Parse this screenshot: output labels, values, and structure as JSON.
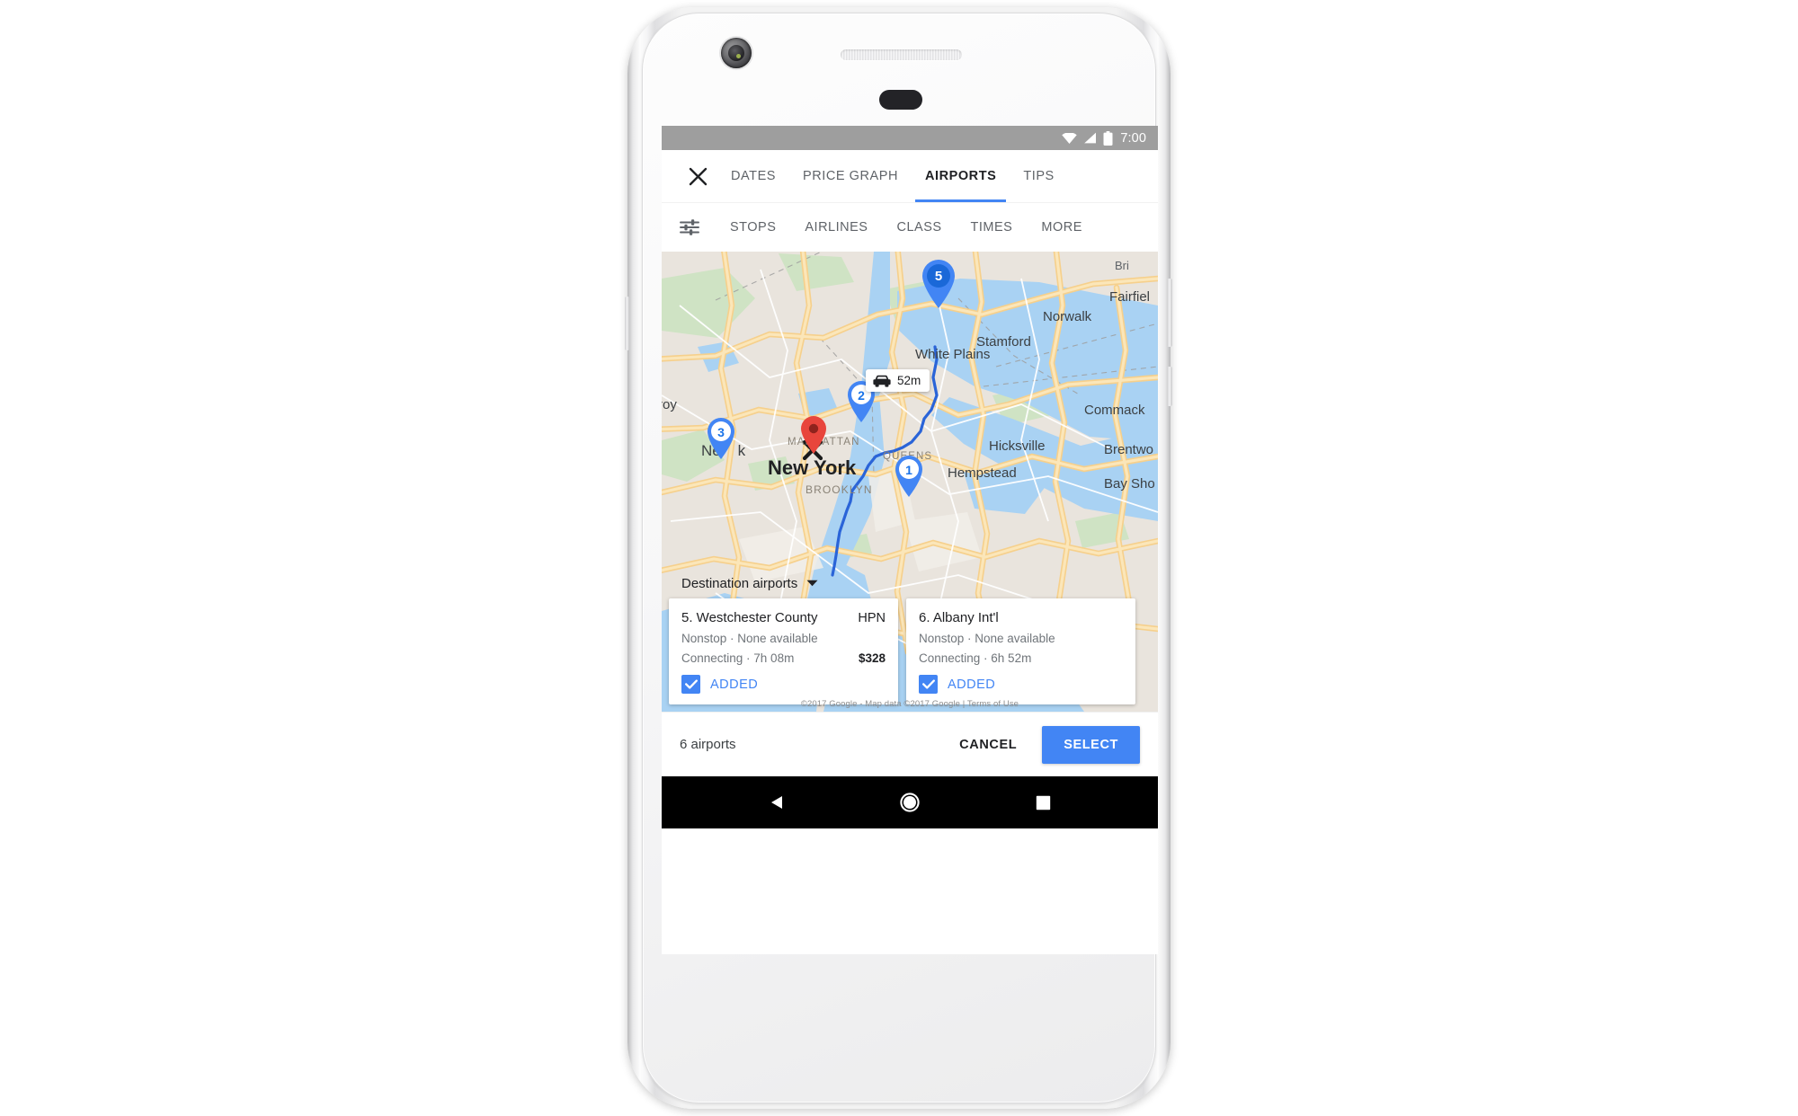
{
  "device": {
    "frame": "google-pixel-white",
    "camera_icon": "front-camera",
    "speaker_icon": "earpiece-speaker",
    "sensor_icon": "proximity-sensor"
  },
  "statusbar": {
    "time": "7:00",
    "wifi_icon": "wifi-icon",
    "signal_icon": "cell-signal-icon",
    "battery_icon": "battery-full-icon"
  },
  "tabbar": {
    "close_icon": "close-icon",
    "tabs": [
      {
        "label": "DATES",
        "active": false
      },
      {
        "label": "PRICE GRAPH",
        "active": false
      },
      {
        "label": "AIRPORTS",
        "active": true
      },
      {
        "label": "TIPS",
        "active": false
      }
    ],
    "active_underline_color": "#4285f4"
  },
  "filterbar": {
    "tune_icon": "tune-filter-icon",
    "chips": [
      "STOPS",
      "AIRLINES",
      "CLASS",
      "TIMES",
      "MORE"
    ]
  },
  "map": {
    "center_label": "New York",
    "place_labels": [
      "White Plains",
      "Stamford",
      "Norwalk",
      "Fairfield",
      "Bridge",
      "Commack",
      "Brentwood",
      "Hicksville",
      "Hempstead",
      "Bay Shore",
      "Newark",
      "Troy",
      "New York",
      "MANHATTAN",
      "BROOKLYN",
      "QUEENS"
    ],
    "drive_badge": {
      "icon": "car-icon",
      "label": "52m"
    },
    "destination_pin": {
      "icon": "destination-pin-red",
      "color": "#e8453c"
    },
    "markers": [
      {
        "number": "5",
        "style": "selected",
        "fill": "#4285f4",
        "text": "#ffffff"
      },
      {
        "number": "2",
        "style": "unselected",
        "fill": "#ffffff",
        "text": "#1a73e8"
      },
      {
        "number": "3",
        "style": "unselected",
        "fill": "#ffffff",
        "text": "#1a73e8"
      },
      {
        "number": "1",
        "style": "unselected",
        "fill": "#ffffff",
        "text": "#1a73e8"
      }
    ],
    "route_color": "#2a64d8",
    "attribution": "©2017 Google - Map data ©2017 Google  |  Terms of Use"
  },
  "dest_panel": {
    "header": "Destination airports",
    "chevron_icon": "chevron-down-icon",
    "cards": [
      {
        "name": "5. Westchester County",
        "code": "HPN",
        "nonstop": "Nonstop · None available",
        "connecting": "Connecting · 7h 08m",
        "price": "$328",
        "added_label": "ADDED",
        "added": true
      },
      {
        "name": "6. Albany Int'l",
        "code": "",
        "nonstop": "Nonstop · None available",
        "connecting": "Connecting · 6h 52m",
        "price": "",
        "added_label": "ADDED",
        "added": true
      }
    ]
  },
  "actionbar": {
    "count": "6 airports",
    "cancel_label": "CANCEL",
    "select_label": "SELECT",
    "select_color": "#4285f4"
  },
  "navbar": {
    "back_icon": "android-back-icon",
    "home_icon": "android-home-icon",
    "recents_icon": "android-recents-icon"
  }
}
